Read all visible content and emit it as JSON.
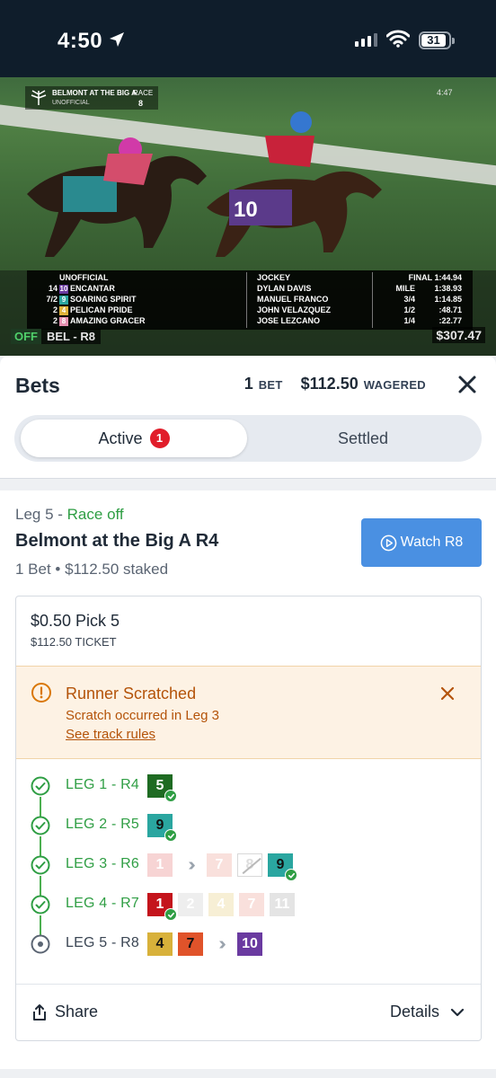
{
  "status_bar": {
    "time": "4:50",
    "battery": "31"
  },
  "video": {
    "track_logo_line1": "BELMONT AT THE BIG A",
    "track_logo_line2": "UNOFFICIAL",
    "race_label": "RACE",
    "race_number": "8",
    "clock": "4:47",
    "results": {
      "header_left": "UNOFFICIAL",
      "header_mid": "JOCKEY",
      "header_right": "FINAL  1:44.94",
      "rows": [
        {
          "odds": "14",
          "pp": "10",
          "pp_color": "#6a3aa0",
          "horse": "ENCANTAR",
          "jockey": "DYLAN DAVIS",
          "split_label": "MILE",
          "split": "1:38.93"
        },
        {
          "odds": "7/2",
          "pp": "9",
          "pp_color": "#2aa6a0",
          "horse": "SOARING SPIRIT",
          "jockey": "MANUEL FRANCO",
          "split_label": "3/4",
          "split": "1:14.85"
        },
        {
          "odds": "2",
          "pp": "4",
          "pp_color": "#e0b33a",
          "horse": "PELICAN PRIDE",
          "jockey": "JOHN VELAZQUEZ",
          "split_label": "1/2",
          "split": ":48.71"
        },
        {
          "odds": "2",
          "pp": "8",
          "pp_color": "#e58fb0",
          "horse": "AMAZING GRACER",
          "jockey": "JOSE LEZCANO",
          "split_label": "1/4",
          "split": ":22.77"
        }
      ]
    },
    "off_tag": "OFF",
    "race_tag": "BEL - R8",
    "pool": "$307.47"
  },
  "header": {
    "title": "Bets",
    "bet_count": "1",
    "bet_label": "BET",
    "wagered_amount": "$112.50",
    "wagered_label": "WAGERED"
  },
  "tabs": {
    "active_label": "Active",
    "active_badge": "1",
    "settled_label": "Settled"
  },
  "bet_card": {
    "leg_prefix": "Leg 5 - ",
    "leg_status": "Race off",
    "race_name": "Belmont at the Big A R4",
    "stake_text": "1 Bet • $112.50 staked",
    "watch_label": "Watch R8",
    "ticket": {
      "title": "$0.50 Pick 5",
      "subtitle": "$112.50 TICKET",
      "alert": {
        "title": "Runner Scratched",
        "message": "Scratch occurred in Leg 3",
        "link": "See track rules"
      },
      "legs": [
        {
          "label": "LEG 1 - R4",
          "state": "won",
          "runners": [
            {
              "num": "5",
              "bg": "#1e6b22",
              "fg": "#ffffff",
              "win": true
            }
          ]
        },
        {
          "label": "LEG 2 - R5",
          "state": "won",
          "runners": [
            {
              "num": "9",
              "bg": "#2aa6a0",
              "fg": "#111111",
              "win": true
            }
          ]
        },
        {
          "label": "LEG 3 - R6",
          "state": "won",
          "runners": [
            {
              "num": "1",
              "bg": "#f7d4d4",
              "fg": "#ffffff",
              "win": false
            },
            {
              "chev": true
            },
            {
              "num": "7",
              "bg": "#f9e0dc",
              "fg": "#ffffff",
              "win": false
            },
            {
              "num": "8",
              "bg": "#ffffff",
              "fg": "#dddddd",
              "win": false,
              "scratched": true
            },
            {
              "num": "9",
              "bg": "#2aa6a0",
              "fg": "#111111",
              "win": true
            }
          ]
        },
        {
          "label": "LEG 4 - R7",
          "state": "won",
          "runners": [
            {
              "num": "1",
              "bg": "#c4141c",
              "fg": "#ffffff",
              "win": true
            },
            {
              "num": "2",
              "bg": "#eeeeee",
              "fg": "#ffffff",
              "win": false
            },
            {
              "num": "4",
              "bg": "#f7efd5",
              "fg": "#ffffff",
              "win": false
            },
            {
              "num": "7",
              "bg": "#f9e0dc",
              "fg": "#ffffff",
              "win": false
            },
            {
              "num": "11",
              "bg": "#e4e4e4",
              "fg": "#ffffff",
              "win": false
            }
          ]
        },
        {
          "label": "LEG 5 - R8",
          "state": "current",
          "runners": [
            {
              "num": "4",
              "bg": "#d8b13a",
              "fg": "#111111",
              "win": false
            },
            {
              "num": "7",
              "bg": "#e0532a",
              "fg": "#111111",
              "win": false
            },
            {
              "chev": true
            },
            {
              "num": "10",
              "bg": "#6a3aa0",
              "fg": "#ffffff",
              "win": false
            }
          ]
        }
      ],
      "share_label": "Share",
      "details_label": "Details"
    }
  },
  "colors": {
    "accent_blue": "#4a90e2",
    "success_green": "#2f9e44",
    "alert_orange": "#b45309",
    "badge_red": "#e11d2a"
  },
  "icons": [
    "location-arrow-icon",
    "signal-icon",
    "wifi-icon",
    "battery-icon",
    "close-icon",
    "play-circle-icon",
    "info-icon",
    "check-circle-icon",
    "radio-dot-icon",
    "share-icon",
    "chevron-down-icon"
  ]
}
